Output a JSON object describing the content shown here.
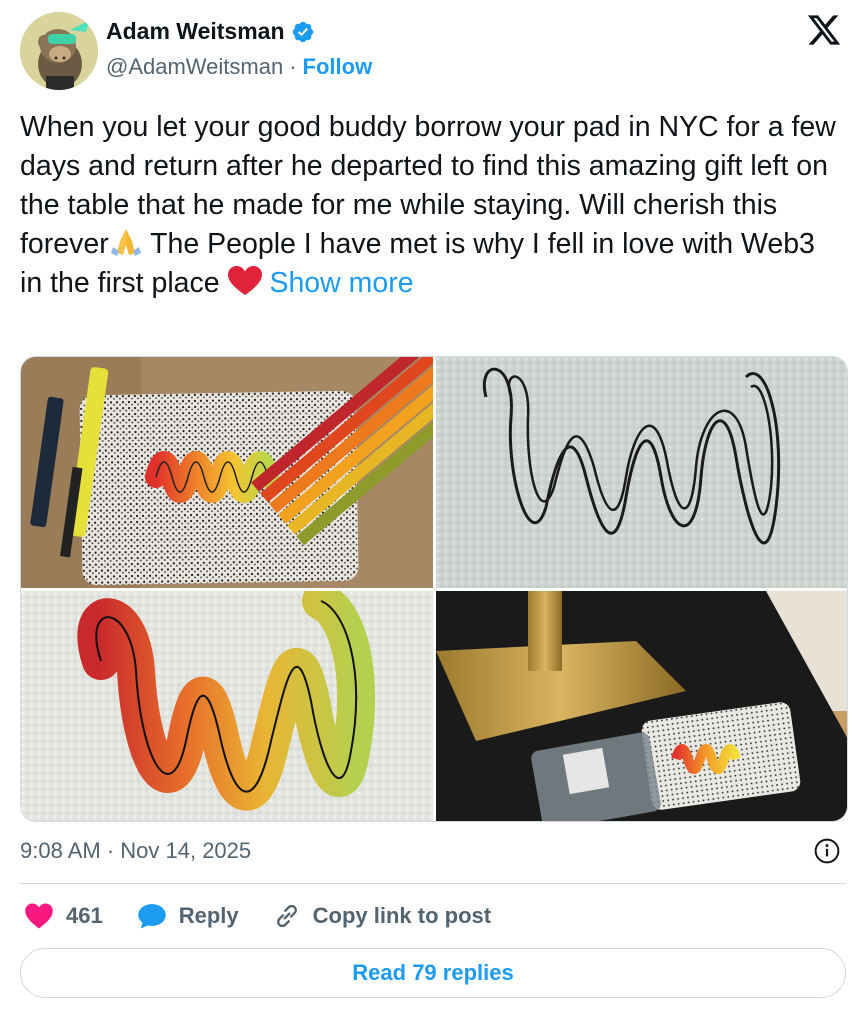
{
  "author": {
    "display_name": "Adam Weitsman",
    "handle": "@AdamWeitsman",
    "separator": "·",
    "follow_label": "Follow",
    "verified": true
  },
  "tweet": {
    "text_line1": "When you let your good buddy borrow your pad in NYC for a few days and return after he departed to find this amazing gift left on the table that he made for me while staying. Will cherish this forever",
    "text_line2": " The People I have met is why I fell in love with Web3 in the first place ",
    "show_more": "Show more",
    "emoji_1": "folded-hands",
    "emoji_2": "red-heart"
  },
  "media": [
    {
      "name": "photo-1"
    },
    {
      "name": "photo-2"
    },
    {
      "name": "photo-3"
    },
    {
      "name": "photo-4"
    }
  ],
  "meta": {
    "timestamp": "9:08 AM · Nov 14, 2025"
  },
  "actions": {
    "likes_count": "461",
    "reply_label": "Reply",
    "copy_link_label": "Copy link to post",
    "read_replies_label": "Read 79 replies"
  },
  "colors": {
    "accent": "#1d9bf0",
    "text": "#0f1419",
    "secondary": "#536471",
    "like": "#f91880",
    "border": "#cfd9de"
  }
}
